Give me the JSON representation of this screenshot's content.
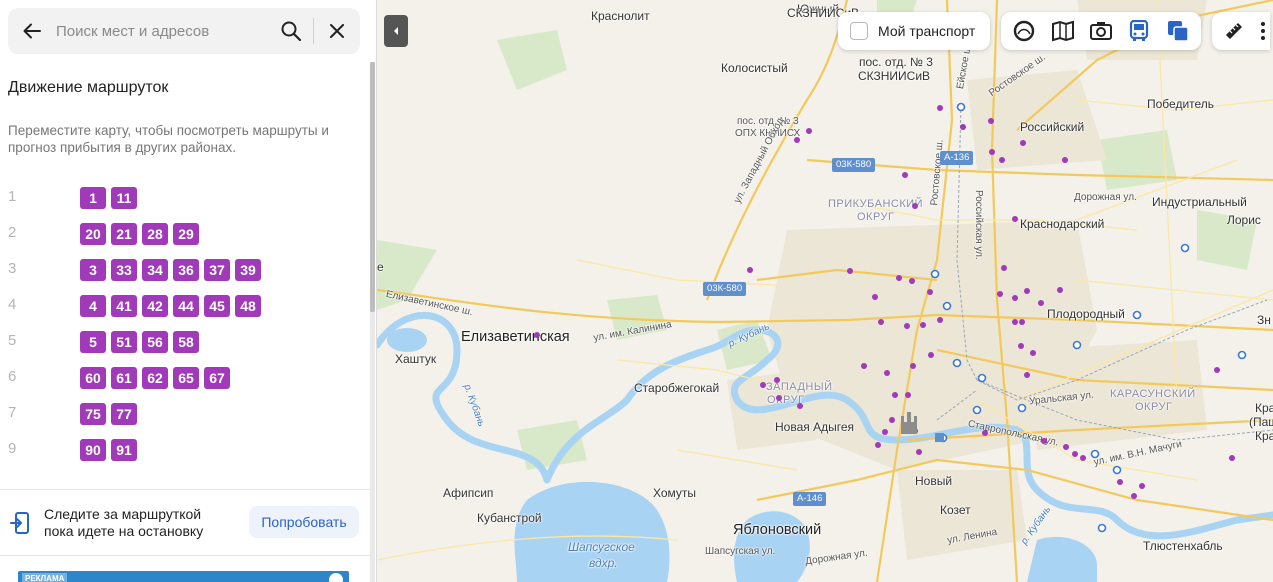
{
  "search": {
    "placeholder": "Поиск мест и адресов"
  },
  "panel": {
    "title": "Движение маршруток",
    "subtitle": "Переместите карту, чтобы посмотреть маршруты и прогноз прибытия в других районах.",
    "route_groups": [
      {
        "group": "1",
        "routes": [
          "1",
          "11"
        ]
      },
      {
        "group": "2",
        "routes": [
          "20",
          "21",
          "28",
          "29"
        ]
      },
      {
        "group": "3",
        "routes": [
          "3",
          "33",
          "34",
          "36",
          "37",
          "39"
        ]
      },
      {
        "group": "4",
        "routes": [
          "4",
          "41",
          "42",
          "44",
          "45",
          "48"
        ]
      },
      {
        "group": "5",
        "routes": [
          "5",
          "51",
          "56",
          "58"
        ]
      },
      {
        "group": "6",
        "routes": [
          "60",
          "61",
          "62",
          "65",
          "67"
        ]
      },
      {
        "group": "7",
        "routes": [
          "75",
          "77"
        ]
      },
      {
        "group": "9",
        "routes": [
          "90",
          "91"
        ]
      }
    ],
    "promo": {
      "text": "Следите за маршруткой пока идете на остановку",
      "button": "Попробовать"
    },
    "ad_label": "РЕКЛАМА"
  },
  "map": {
    "my_transport_label": "Мой транспорт",
    "labels": {
      "krasnolit": "Краснолит",
      "yuzhny": "Южный",
      "skzniisiv_top": "СКЗНИИСиВ",
      "kolosisty": "Колосистый",
      "pos3_skz": "пос. отд. № 3",
      "skzniisiv": "СКЗНИИСиВ",
      "pobeditel": "Победитель",
      "pos3_opkh": "пос. отд. № 3",
      "opkh": "ОПХ КНИИСХ",
      "rossiysky": "Российский",
      "prikuban_1": "ПРИКУБАНСКИЙ",
      "prikuban_2": "ОКРУГ",
      "industrialny": "Индустриальный",
      "loris": "Лорис",
      "krasnodarsky": "Краснодарский",
      "plodorodny": "Плодородный",
      "elizavetinskaya": "Елизаветинская",
      "khashtuk": "Хаштук",
      "starobzhegokay": "Старобжегокай",
      "zapadny_1": "ЗАПАДНЫЙ",
      "zapadny_2": "ОКРУГ",
      "karasun_1": "КАРАСУНСКИЙ",
      "karasun_2": "ОКРУГ",
      "novaya_adygeya": "Новая Адыгея",
      "afipsip": "Афипсип",
      "khomuty": "Хомуты",
      "kubanstroy": "Кубанстрой",
      "novy": "Новый",
      "kozet": "Козет",
      "yablonovsky": "Яблоновский",
      "tlyustenkhabl": "Тлюстенхабль",
      "krasn_1": "Крас",
      "krasn_2": "(Пашко",
      "krasn_3": "Крас",
      "shapsug_1": "Шапсугское",
      "shapsug_2": "вдхр.",
      "e": "е",
      "zhn": "Зн"
    },
    "streets": {
      "zapadny_obkhod": "ул. Западный Обход",
      "kalinina": "ул. им. Калинина",
      "rostovskoe": "Ростовское ш.",
      "eyskoe": "Ейское ш.",
      "rossiyskaya": "Российская ул.",
      "dorozhnaya": "Дорожная ул.",
      "elizavetinskoe": "Елизаветинское ш.",
      "uralskaya": "Уральская ул.",
      "stavropolskaya": "Ставропольская ул.",
      "machugi": "ул. им. В.Н. Мачуги",
      "shapsugskaya": "Шапсугская ул.",
      "dorozhnaya2": "Дорожная ул.",
      "lenina": "ул. Ленина",
      "rostovskoe_v": "Ростовское ш.",
      "r_kuban": "р. Кубань",
      "r_kuban2": "р. Кубань",
      "r_kuban3": "р. Кубань"
    },
    "highways": {
      "h1": "03К-580",
      "h2": "03К-580",
      "h3": "А-136",
      "h4": "А-146"
    }
  }
}
